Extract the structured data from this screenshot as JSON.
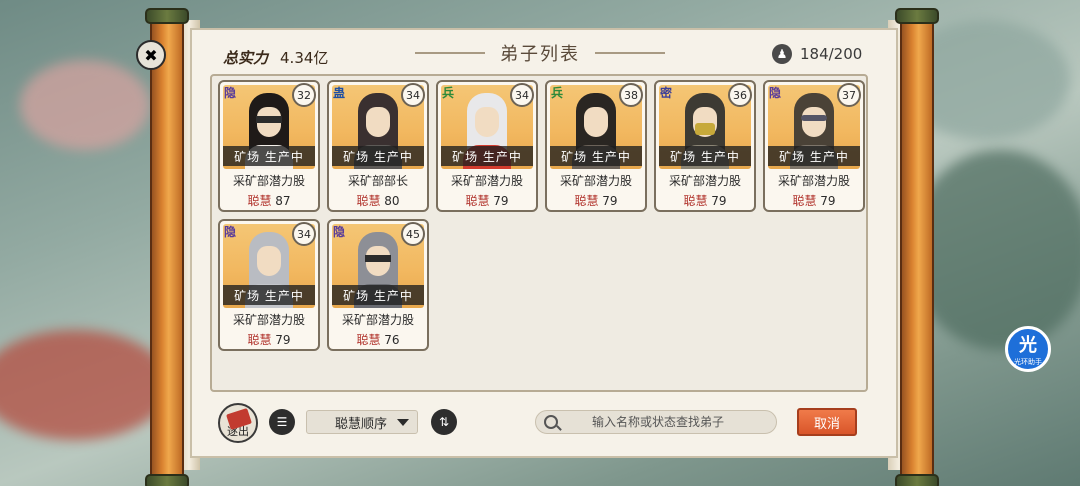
{
  "header": {
    "power_label": "总实力",
    "power_value": "4.34亿",
    "title": "弟子列表",
    "count": "184/200"
  },
  "disciples": [
    {
      "rank": "隐",
      "rank_class": "yin",
      "level": "32",
      "status": "矿场 生产中",
      "role": "采矿部潜力股",
      "stat_label": "聪慧",
      "stat_value": "87",
      "hair": "#1f1a18",
      "robe": "#f5f0ea",
      "accessory": "band"
    },
    {
      "rank": "蛊",
      "rank_class": "gu",
      "level": "34",
      "status": "矿场 生产中",
      "role": "采矿部部长",
      "stat_label": "聪慧",
      "stat_value": "80",
      "hair": "#3a3030",
      "robe": "#5d5a57",
      "accessory": "none"
    },
    {
      "rank": "兵",
      "rank_class": "bing",
      "level": "34",
      "status": "矿场 生产中",
      "role": "采矿部潜力股",
      "stat_label": "聪慧",
      "stat_value": "79",
      "hair": "#e8e8ea",
      "robe": "#d23b2e",
      "accessory": "none"
    },
    {
      "rank": "兵",
      "rank_class": "bing",
      "level": "38",
      "status": "矿场 生产中",
      "role": "采矿部潜力股",
      "stat_label": "聪慧",
      "stat_value": "79",
      "hair": "#2a2622",
      "robe": "#6b6259",
      "accessory": "none"
    },
    {
      "rank": "密",
      "rank_class": "mi",
      "level": "36",
      "status": "矿场 生产中",
      "role": "采矿部潜力股",
      "stat_label": "聪慧",
      "stat_value": "79",
      "hair": "#3d3a33",
      "robe": "#8b8575",
      "accessory": "mask"
    },
    {
      "rank": "隐",
      "rank_class": "yin",
      "level": "37",
      "status": "矿场 生产中",
      "role": "采矿部潜力股",
      "stat_label": "聪慧",
      "stat_value": "79",
      "hair": "#4a4237",
      "robe": "#7d756a",
      "accessory": "glasses"
    },
    {
      "rank": "隐",
      "rank_class": "yin",
      "level": "34",
      "status": "矿场 生产中",
      "role": "采矿部潜力股",
      "stat_label": "聪慧",
      "stat_value": "79",
      "hair": "#b9bcc2",
      "robe": "#c4c6cb",
      "accessory": "none"
    },
    {
      "rank": "隐",
      "rank_class": "yin",
      "level": "45",
      "status": "矿场 生产中",
      "role": "采矿部潜力股",
      "stat_label": "聪慧",
      "stat_value": "76",
      "hair": "#8d8f96",
      "robe": "#6a6c72",
      "accessory": "band"
    }
  ],
  "toolbar": {
    "exit_label": "逐出",
    "sort_label": "聪慧顺序",
    "search_placeholder": "输入名称或状态查找弟子",
    "cancel_label": "取消"
  },
  "assistant": {
    "glyph": "光",
    "label": "光环助手"
  },
  "colors": {
    "accent": "#e8642f",
    "paper": "#f6f2e9",
    "rod": "#d9812f"
  }
}
